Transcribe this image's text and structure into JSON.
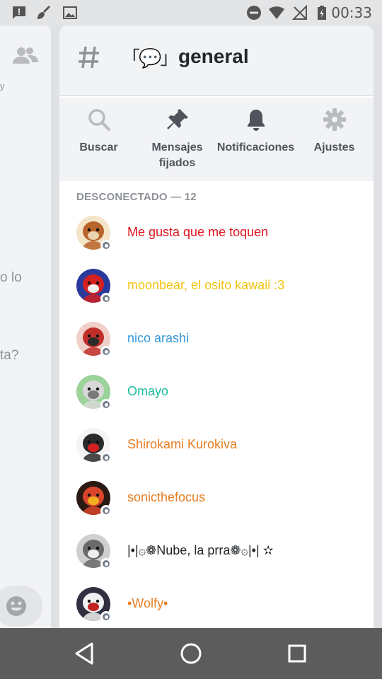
{
  "status_bar": {
    "time": "00:33",
    "icons": [
      "message-alert-icon",
      "broom-icon",
      "image-icon",
      "do-not-disturb-icon",
      "wifi-icon",
      "no-signal-icon",
      "battery-charging-icon"
    ]
  },
  "left_panel": {
    "text_fragments": [
      "y",
      "o lo",
      "ta?"
    ],
    "icons": [
      "members-icon",
      "emoji-icon"
    ]
  },
  "channel": {
    "emoji": "「💬」",
    "name": "general"
  },
  "toolbar": {
    "items": [
      {
        "label": "Buscar",
        "icon": "search-icon"
      },
      {
        "label": "Mensajes fijados",
        "icon": "pin-icon"
      },
      {
        "label": "Notificaciones",
        "icon": "bell-icon"
      },
      {
        "label": "Ajustes",
        "icon": "gear-icon"
      }
    ]
  },
  "members_section": {
    "title": "DESCONECTADO — 12",
    "members": [
      {
        "name": "Me gusta que me toquen",
        "color": "#e0141e"
      },
      {
        "name": "moonbear, el osito kawaii :3",
        "color": "#f1c40f"
      },
      {
        "name": "nico arashi",
        "color": "#3498db"
      },
      {
        "name": "Omayo",
        "color": "#1abc9c"
      },
      {
        "name": "Shirokami Kurokiva",
        "color": "#e67e22"
      },
      {
        "name": "sonicthefocus",
        "color": "#e67e22"
      },
      {
        "name": "|•|۞❁Nube, la prra❁۞|•| ✫",
        "color": "#23272a"
      },
      {
        "name": "•Wolfy•",
        "color": "#e67e22"
      }
    ]
  },
  "nav_bar": {
    "buttons": [
      "back-icon",
      "home-icon",
      "recents-icon"
    ]
  },
  "colors": {
    "accent": "#4f545c",
    "offline": "#747f8d",
    "nav_bg": "#5c5c5c"
  }
}
